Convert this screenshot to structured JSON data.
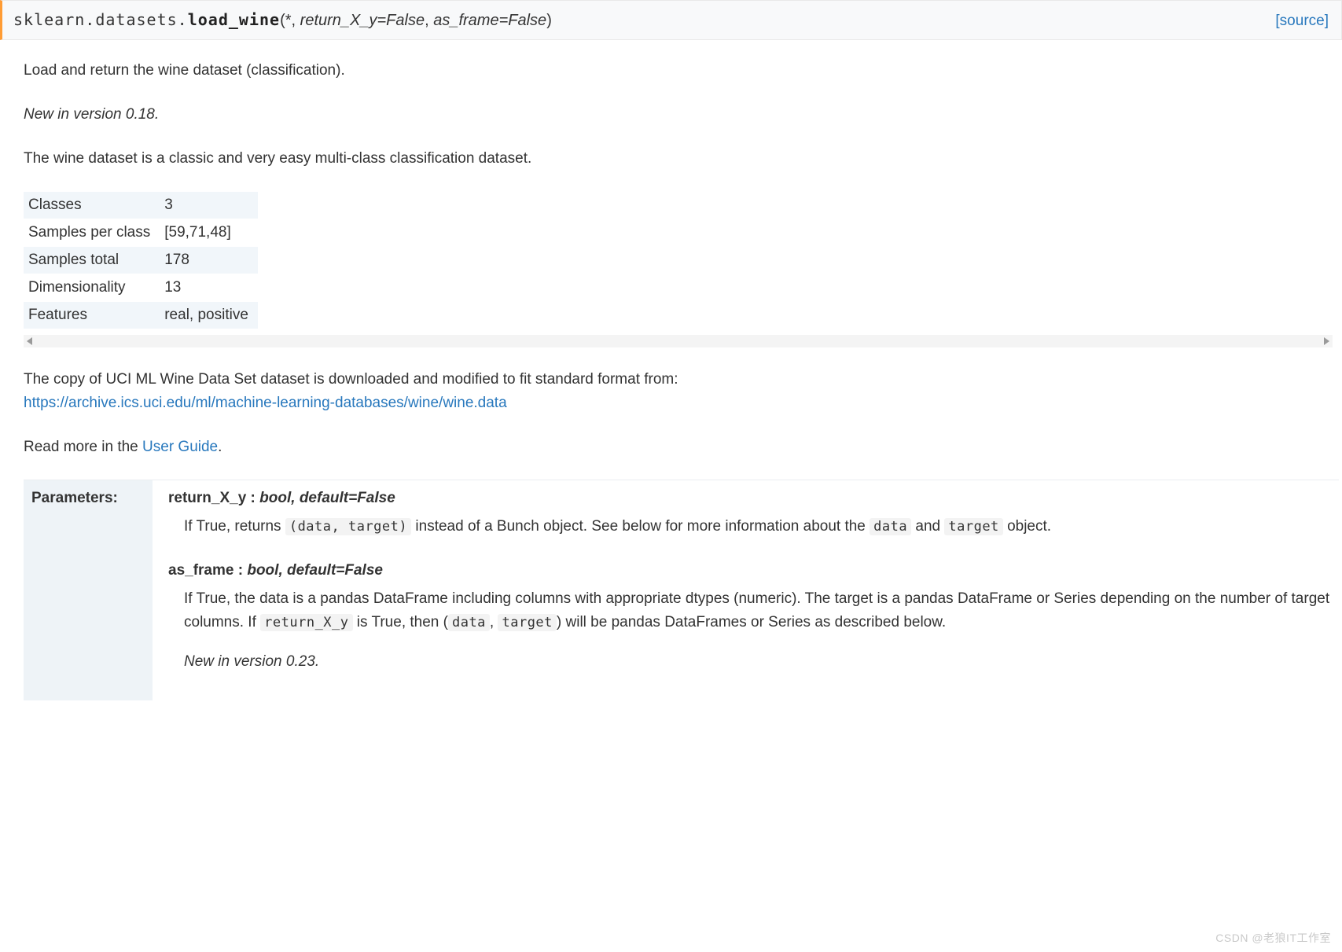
{
  "signature": {
    "module": "sklearn.datasets.",
    "func": "load_wine",
    "open": "(",
    "star": "*, ",
    "kw1_name": "return_X_y",
    "kw1_eq": "=False",
    "sep": ", ",
    "kw2_name": "as_frame",
    "kw2_eq": "=False",
    "close": ")",
    "source_label": "[source]"
  },
  "intro": {
    "p1": "Load and return the wine dataset (classification).",
    "version": "New in version 0.18.",
    "p2": "The wine dataset is a classic and very easy multi-class classification dataset."
  },
  "summary": {
    "rows": [
      {
        "k": "Classes",
        "v": "3"
      },
      {
        "k": "Samples per class",
        "v": "[59,71,48]"
      },
      {
        "k": "Samples total",
        "v": "178"
      },
      {
        "k": "Dimensionality",
        "v": "13"
      },
      {
        "k": "Features",
        "v": "real, positive"
      }
    ]
  },
  "dataset_note": {
    "lead": "The copy of UCI ML Wine Data Set dataset is downloaded and modified to fit standard format from:",
    "url_text": "https://archive.ics.uci.edu/ml/machine-learning-databases/wine/wine.data"
  },
  "readmore": {
    "prefix": "Read more in the ",
    "link": "User Guide",
    "suffix": "."
  },
  "params_header": "Parameters:",
  "params": [
    {
      "name": "return_X_y",
      "type": "bool, default=False",
      "desc_parts": [
        {
          "t": "If True, returns "
        },
        {
          "c": "(data, target)"
        },
        {
          "t": " instead of a Bunch object. See below for more information about the "
        },
        {
          "c": "data"
        },
        {
          "t": " and "
        },
        {
          "c": "target"
        },
        {
          "t": " object."
        }
      ],
      "version": ""
    },
    {
      "name": "as_frame",
      "type": "bool, default=False",
      "desc_parts": [
        {
          "t": "If True, the data is a pandas DataFrame including columns with appropriate dtypes (numeric). The target is a pandas DataFrame or Series depending on the number of target columns. If "
        },
        {
          "c": "return_X_y"
        },
        {
          "t": " is True, then ("
        },
        {
          "c": "data"
        },
        {
          "t": ", "
        },
        {
          "c": "target"
        },
        {
          "t": ") will be pandas DataFrames or Series as described below."
        }
      ],
      "version": "New in version 0.23."
    }
  ],
  "watermark": "CSDN @老狼IT工作室"
}
